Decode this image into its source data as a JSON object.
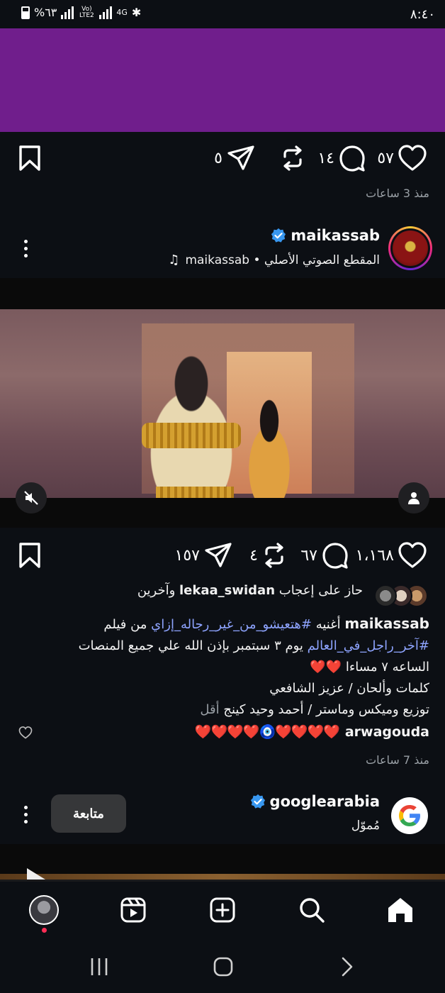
{
  "status_bar": {
    "time": "٨:٤٠",
    "battery": "%٦٣",
    "network": "4G",
    "lte": "Vo) LTE2"
  },
  "post1": {
    "likes": "٥٧",
    "comments": "١٤",
    "shares": "٥",
    "time_ago": "منذ 3 ساعات"
  },
  "post2": {
    "username": "maikassab",
    "audio_line": "المقطع الصوتي الأصلي • maikassab",
    "likes": "١،١٦٨",
    "comments": "٦٧",
    "reposts": "٤",
    "shares": "١٥٧",
    "liked_by_prefix": "حاز على إعجاب",
    "liked_by_user": "lekaa_swidan",
    "liked_by_suffix": "وآخرين",
    "caption_user": "maikassab",
    "caption_word1": "أغنيه",
    "caption_tag1": "#هتعيشو_من_غير_رجاله_إزاي",
    "caption_word2": "من فيلم",
    "caption_tag2": "#آخر_راجل_في_العالم",
    "caption_line2_rest": "يوم ٣ سبتمبر بإذن الله علي جميع المنصات",
    "caption_line3": "الساعه ٧ مساءا",
    "caption_line3_hearts": "❤️❤️",
    "caption_line4": "كلمات وألحان / عزيز الشافعي",
    "caption_line5": "توزيع وميكس وماستر / أحمد وحيد كينج",
    "caption_more": "أقل",
    "comment_user": "arwagouda",
    "comment_hearts": "❤️❤️❤️❤️🧿❤️❤️❤️❤️",
    "time_ago": "منذ 7 ساعات"
  },
  "post3": {
    "username": "googlearabia",
    "sponsored": "مُموّل",
    "follow_label": "متابعة"
  },
  "icons": {
    "like": "heart-icon",
    "comment": "comment-icon",
    "repost": "repost-icon",
    "share": "send-icon",
    "save": "bookmark-icon",
    "home": "home-icon",
    "search": "search-icon",
    "create": "plus-square-icon",
    "reels": "reels-icon",
    "profile": "avatar"
  },
  "colors": {
    "banner": "#701e8c",
    "link": "#8ea4ff",
    "verified": "#3897f0",
    "heart": "#ff4a78"
  }
}
